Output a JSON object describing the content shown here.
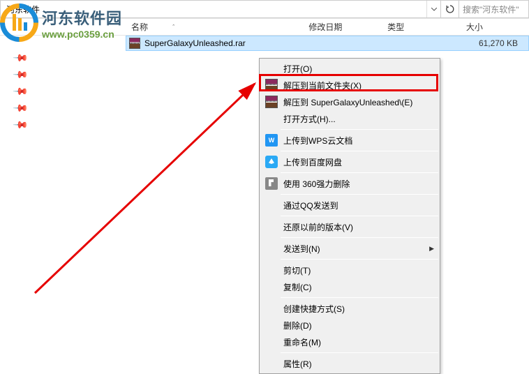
{
  "addressbar": {
    "path": "河东软件",
    "search_placeholder": "搜索\"河东软件\""
  },
  "watermark": {
    "title": "河东软件园",
    "url": "www.pc0359.cn"
  },
  "columns": {
    "name": "名称",
    "date": "修改日期",
    "type": "类型",
    "size": "大小"
  },
  "file": {
    "name": "SuperGalaxyUnleashed.rar",
    "size": "61,270 KB"
  },
  "context_menu": {
    "open": "打开(O)",
    "extract_here": "解压到当前文件夹(X)",
    "extract_to": "解压到 SuperGalaxyUnleashed\\(E)",
    "open_with": "打开方式(H)...",
    "upload_wps": "上传到WPS云文档",
    "upload_baidu": "上传到百度网盘",
    "force_delete_360": "使用 360强力删除",
    "send_qq": "通过QQ发送到",
    "restore_prev": "还原以前的版本(V)",
    "send_to": "发送到(N)",
    "cut": "剪切(T)",
    "copy": "复制(C)",
    "create_shortcut": "创建快捷方式(S)",
    "delete": "删除(D)",
    "rename": "重命名(M)",
    "properties": "属性(R)"
  }
}
